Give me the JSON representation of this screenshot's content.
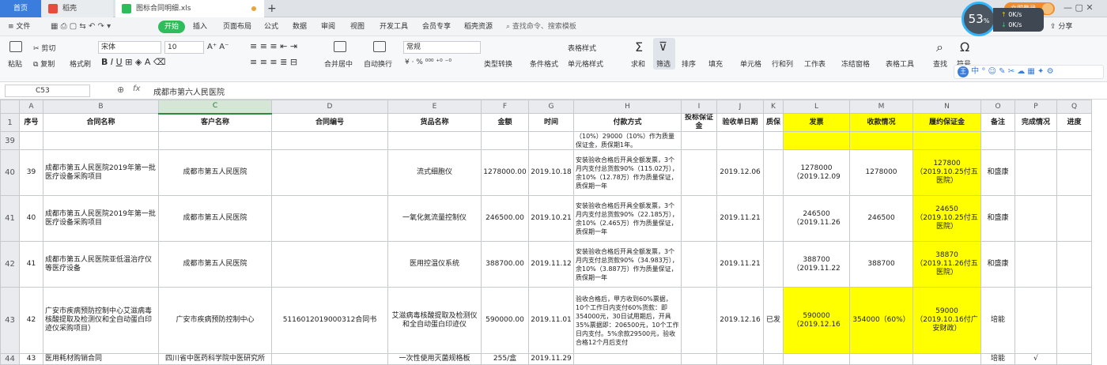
{
  "tabs": {
    "home": "首页",
    "doc": "稻壳",
    "file": "图标合同明细.xls",
    "add": "+"
  },
  "menu": [
    "≡ 文件",
    "开始",
    "插入",
    "页面布局",
    "公式",
    "数据",
    "审阅",
    "视图",
    "开发工具",
    "会员专享",
    "稻壳资源"
  ],
  "menu_search": "查找命令、搜索模板",
  "share": "分享",
  "ribbon": {
    "paste": "粘贴",
    "cut": "剪切",
    "copy": "复制",
    "format_painter": "格式刷",
    "font": "宋体",
    "size": "10",
    "merge": "合并居中",
    "wrap": "自动换行",
    "number_format": "常规",
    "type_convert": "类型转换",
    "cond_format": "条件格式",
    "table_style": "表格样式",
    "cell_style": "单元格样式",
    "sum": "求和",
    "filter": "筛选",
    "sort": "排序",
    "fill": "填充",
    "cell": "单元格",
    "rowcol": "行和列",
    "sheet": "工作表",
    "freeze": "冻结窗格",
    "table_tools": "表格工具",
    "find": "查找",
    "symbol": "符号"
  },
  "perf": {
    "pct": "53",
    "pct_unit": "%",
    "up": "0",
    "down": "0",
    "unit": "K/s"
  },
  "formula": {
    "cell_ref": "C53",
    "fx": "fx",
    "content": "成都市第六人民医院"
  },
  "cols": [
    "A",
    "B",
    "C",
    "D",
    "E",
    "F",
    "G",
    "H",
    "I",
    "J",
    "K",
    "L",
    "M",
    "N",
    "O",
    "P",
    "Q"
  ],
  "headers": [
    "序号",
    "合同名称",
    "客户名称",
    "合同编号",
    "货品名称",
    "金额",
    "时间",
    "付款方式",
    "投标保证金",
    "验收单日期",
    "质保",
    "发票",
    "收款情况",
    "履约保证金",
    "备注",
    "完成情况",
    "进度"
  ],
  "rows": [
    {
      "num": "39",
      "cells": [
        "",
        "",
        "",
        "",
        "",
        "",
        "",
        "（10%）29000（10%）作为质量保证金，质保期1年。",
        "",
        "",
        "",
        "",
        "",
        "",
        "",
        "",
        ""
      ]
    },
    {
      "num": "40",
      "cells": [
        "39",
        "成都市第五人民医院2019年第一批医疗设备采购项目",
        "成都市第五人民医院",
        "",
        "流式细胞仪",
        "1278000.00",
        "2019.10.18",
        "安装验收合格后开具全额发票，3个月内支付总货款90%（115.02万），余10%（12.78万）作为质量保证，质保期一年",
        "",
        "2019.12.06",
        "",
        "1278000（2019.12.09",
        "1278000",
        "127800（2019.10.25付五医院）",
        "和盛康",
        "",
        ""
      ]
    },
    {
      "num": "41",
      "cells": [
        "40",
        "成都市第五人民医院2019年第一批医疗设备采购项目",
        "成都市第五人民医院",
        "",
        "一氧化氮流量控制仪",
        "246500.00",
        "2019.10.21",
        "安装验收合格后开具全额发票，3个月内支付总货款90%（22.185万），余10%（2.465万）作为质量保证，质保期一年",
        "",
        "2019.11.21",
        "",
        "246500（2019.11.26",
        "246500",
        "24650（2019.10.25付五医院）",
        "和盛康",
        "",
        ""
      ]
    },
    {
      "num": "42",
      "cells": [
        "41",
        "成都市第五人民医院亚低温治疗仪等医疗设备",
        "成都市第五人民医院",
        "",
        "医用控温仪系统",
        "388700.00",
        "2019.11.12",
        "安装验收合格后开具全额发票，3个月内支付总货款90%（34.983万），余10%（3.887万）作为质量保证，质保期一年",
        "",
        "2019.11.21",
        "",
        "388700（2019.11.22",
        "388700",
        "38870（2019.11.26付五医院）",
        "和盛康",
        "",
        ""
      ]
    },
    {
      "num": "43",
      "cells": [
        "42",
        "广安市疾病预防控制中心艾滋病毒核酸提取及检测仪和全自动蛋白印迹仪采购项目）",
        "广安市疾病预防控制中心",
        "511601201900031​2合同书",
        "艾滋病毒核酸提取及检测仪和全自动蛋白印迹仪",
        "590000.00",
        "2019.11.01",
        "验收合格后，甲方收到60%票据，10个工作日内支付60%货款：即354000元，30日试用期后，开具35%票据即：206500元，10个工作日内支付。5%余款29500元，验收合格12个月后支付",
        "",
        "2019.12.16",
        "已发",
        "590000（2019.12.16",
        "354000（60%）",
        "59000（2019.10.16付广安财政）",
        "培能",
        "",
        ""
      ]
    },
    {
      "num": "44",
      "cells": [
        "43",
        "医用耗材购销合同",
        "四川省中医药科学院中医研究所",
        "",
        "一次性使用灭菌规格板",
        "255/盒",
        "2019.11.29",
        "",
        "",
        "",
        "",
        "",
        "",
        "",
        "培能",
        "√",
        ""
      ]
    }
  ]
}
